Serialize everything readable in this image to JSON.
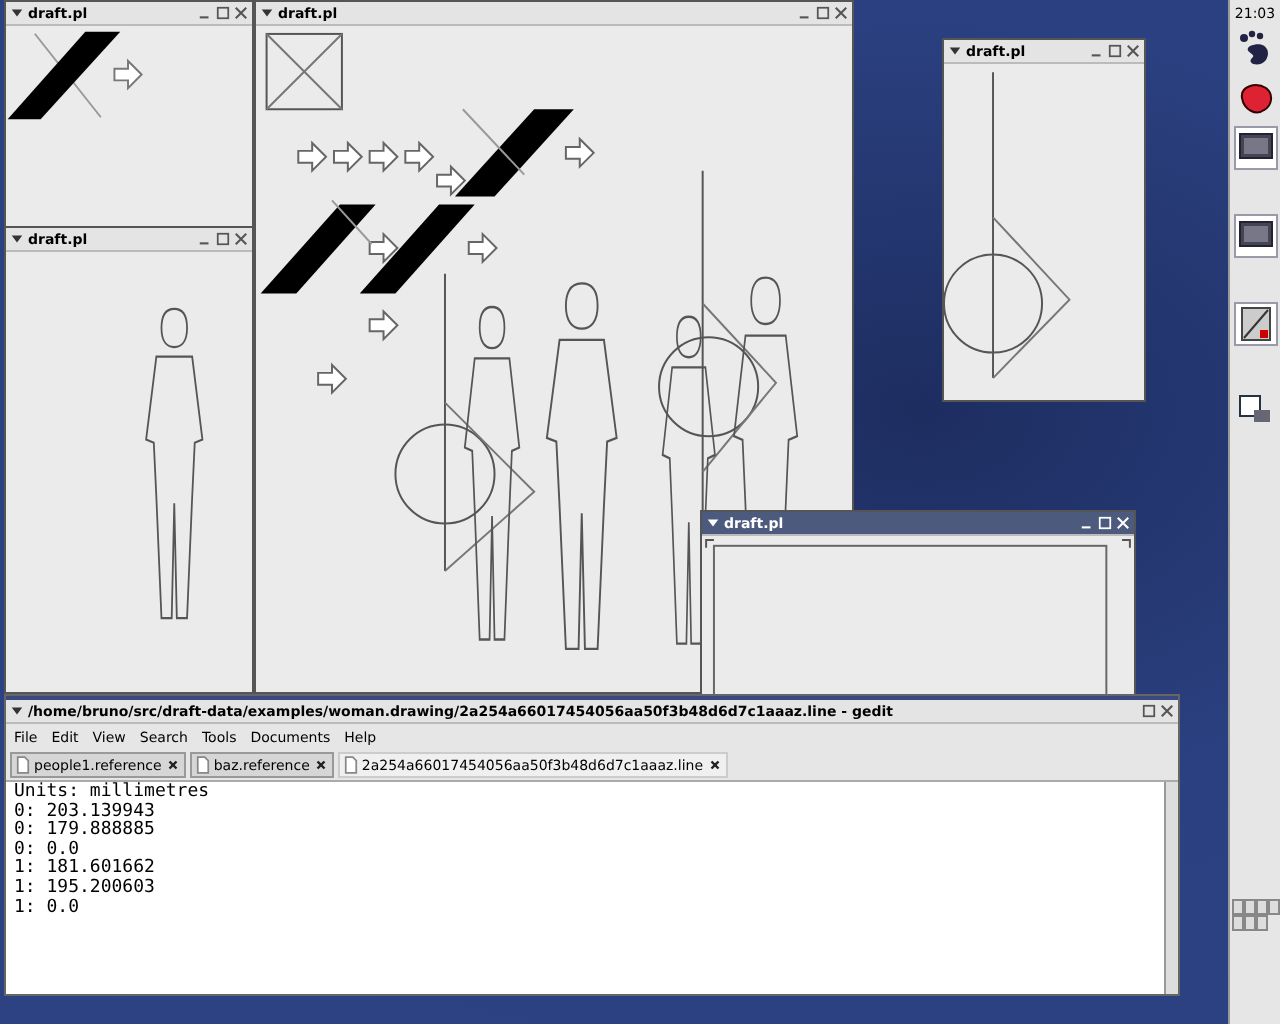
{
  "windows": [
    {
      "kind": "arrow",
      "title": "draft.pl",
      "active": false
    },
    {
      "kind": "figure",
      "title": "draft.pl",
      "active": false
    },
    {
      "kind": "scene",
      "title": "draft.pl",
      "active": false
    },
    {
      "kind": "circle",
      "title": "draft.pl",
      "active": false
    },
    {
      "kind": "sheet",
      "title": "draft.pl",
      "active": true
    }
  ],
  "editor": {
    "title": "/home/bruno/src/draft-data/examples/woman.drawing/2a254a66017454056aa50f3b48d6d7c1aaaz.line - gedit",
    "active": false,
    "menu": [
      "File",
      "Edit",
      "View",
      "Search",
      "Tools",
      "Documents",
      "Help"
    ],
    "tabs": [
      {
        "label": "people1.reference",
        "selected": false
      },
      {
        "label": "baz.reference",
        "selected": false
      },
      {
        "label": "2a254a66017454056aa50f3b48d6d7c1aaaz.line",
        "selected": true
      }
    ],
    "lines": [
      "Units: millimetres",
      "0: 203.139943",
      "0: 179.888885",
      "0: 0.0",
      "1: 181.601662",
      "1: 195.200603",
      "1: 0.0"
    ]
  },
  "panel": {
    "clock": "21:03"
  }
}
